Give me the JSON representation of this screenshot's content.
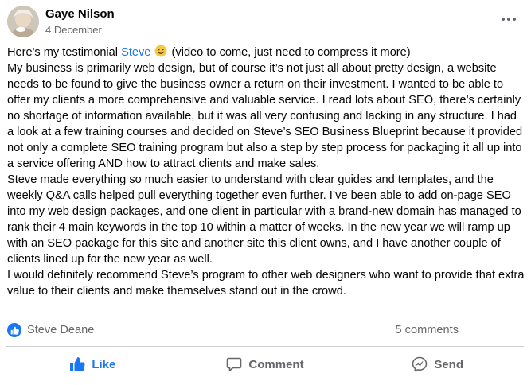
{
  "post": {
    "author": "Gaye Nilson",
    "date": "4 December",
    "paragraphs": {
      "intro_before": "Here's my testimonial ",
      "intro_mention": "Steve",
      "intro_after": " (video to come, just need to compress it more)",
      "p1": "My business is primarily web design, but of course it’s not just all about pretty design, a website needs to be found to give the business owner a return on their investment. I wanted to be able to offer my clients a more comprehensive and valuable service. I read lots about SEO, there’s certainly no shortage of information available, but it was all very confusing and lacking in any structure. I had a look at a few training courses and decided on Steve’s SEO Business Blueprint because it provided not only a complete SEO training program but also a step by step process for packaging it all up into a service offering AND how to attract clients and make sales.",
      "p2": "Steve made everything so much easier to understand with clear guides and templates, and the weekly Q&A calls helped pull everything together even further. I’ve been able to add on-page SEO into my web design packages, and one client in particular with a brand-new domain has managed to rank their 4 main keywords in the top 10 within a matter of weeks. In the new year we will ramp up with an SEO package for this site and another site this client owns, and I have another couple of clients lined up for the new year as well.",
      "p3": "I would definitely recommend Steve’s program to other web designers who want to provide that extra value to their clients and make themselves stand out in the crowd."
    },
    "reactions": {
      "reactor": "Steve Deane",
      "comments": "5 comments"
    },
    "actions": {
      "like": "Like",
      "comment": "Comment",
      "send": "Send"
    },
    "colors": {
      "link": "#1877f2",
      "secondary_text": "#65676b",
      "liked": "#1877f2"
    },
    "icons": {
      "reaction": "thumbs-up-icon",
      "emoji": "smiley-icon",
      "more": "more-dots-icon",
      "comment": "comment-bubble-icon",
      "send": "messenger-icon"
    }
  }
}
